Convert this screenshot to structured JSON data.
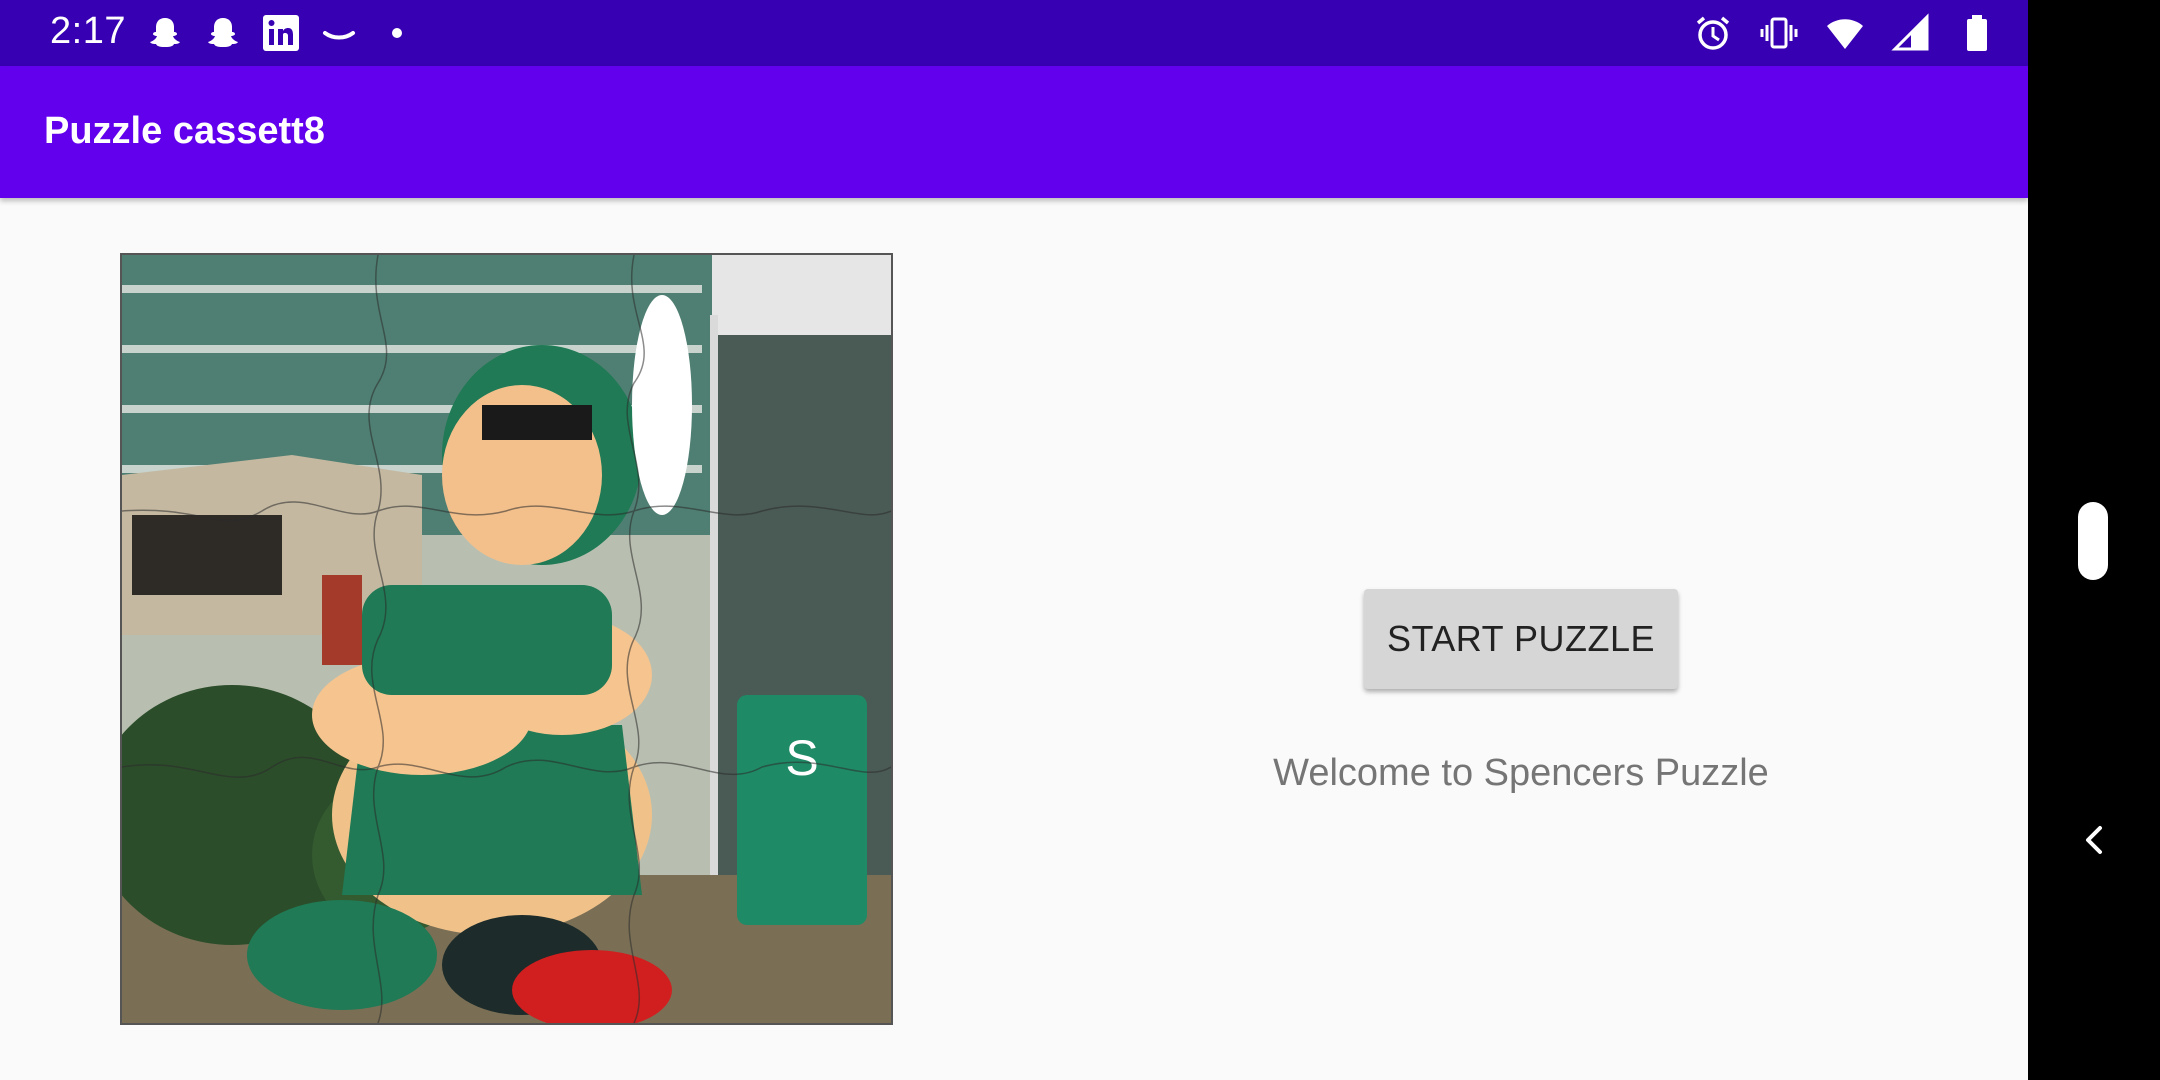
{
  "status_bar": {
    "time": "2:17",
    "notification_icons": [
      "snapchat-icon",
      "snapchat-icon",
      "linkedin-icon",
      "amazon-icon",
      "dot-icon"
    ],
    "system_icons": [
      "alarm-icon",
      "vibrate-icon",
      "wifi-icon",
      "signal-icon",
      "battery-icon"
    ]
  },
  "app_bar": {
    "title": "Puzzle cassett8"
  },
  "main": {
    "start_button_label": "START PUZZLE",
    "welcome_text": "Welcome to Spencers Puzzle"
  },
  "colors": {
    "status_bar": "#3700b3",
    "app_bar": "#6200ee",
    "background": "#fafafa",
    "button": "#d6d6d6",
    "nav_bar": "#000000"
  }
}
